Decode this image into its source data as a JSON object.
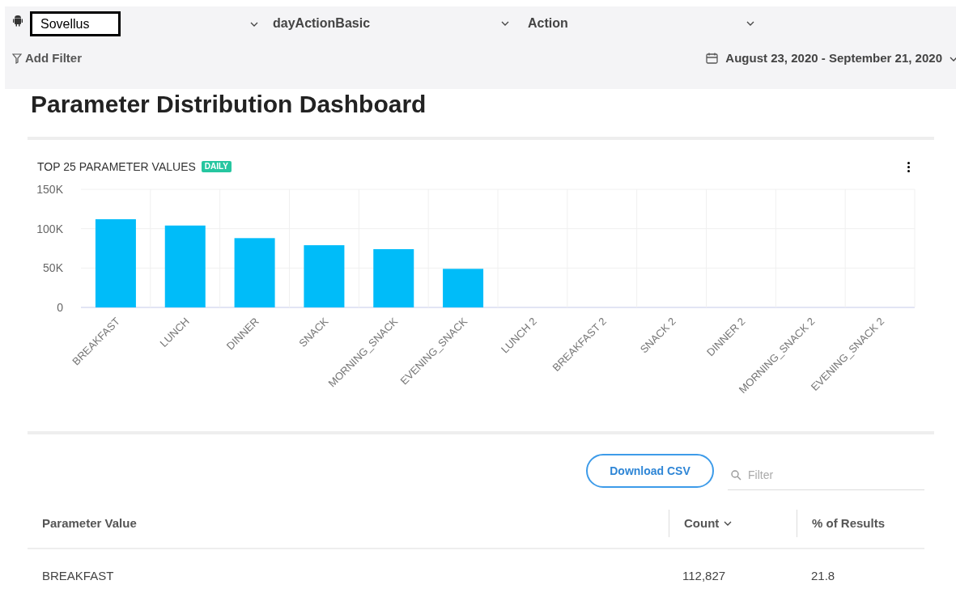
{
  "top_bar": {
    "app_selector": {
      "value": "Sovellus"
    },
    "event_selector": {
      "value": "dayActionBasic"
    },
    "parameter_selector": {
      "value": "Action"
    },
    "add_filter": "Add Filter",
    "date_range": "August 23, 2020 - September 21, 2020"
  },
  "title": "Parameter Distribution Dashboard",
  "chart_card": {
    "title": "TOP 25 PARAMETER VALUES",
    "badge": "DAILY",
    "chart_data": {
      "type": "bar",
      "categories": [
        "BREAKFAST",
        "LUNCH",
        "DINNER",
        "SNACK",
        "MORNING_SNACK",
        "EVENING_SNACK",
        "LUNCH 2",
        "BREAKFAST 2",
        "SNACK 2",
        "DINNER 2",
        "MORNING_SNACK 2",
        "EVENING_SNACK 2"
      ],
      "values": [
        112000,
        104000,
        88000,
        79000,
        74000,
        49000,
        0,
        0,
        0,
        0,
        0,
        0
      ],
      "ylim": [
        0,
        150000
      ],
      "yticks": [
        {
          "value": 0,
          "label": "0"
        },
        {
          "value": 50000,
          "label": "50K"
        },
        {
          "value": 100000,
          "label": "100K"
        },
        {
          "value": 150000,
          "label": "150K"
        }
      ]
    }
  },
  "table": {
    "download_button": "Download CSV",
    "filter": {
      "placeholder": "Filter"
    },
    "columns": [
      {
        "label": "Parameter Value",
        "sorted": false
      },
      {
        "label": "Count",
        "sorted": true
      },
      {
        "label": "% of Results",
        "sorted": false
      }
    ],
    "rows": [
      [
        "BREAKFAST",
        "112,827",
        "21.8"
      ]
    ]
  }
}
